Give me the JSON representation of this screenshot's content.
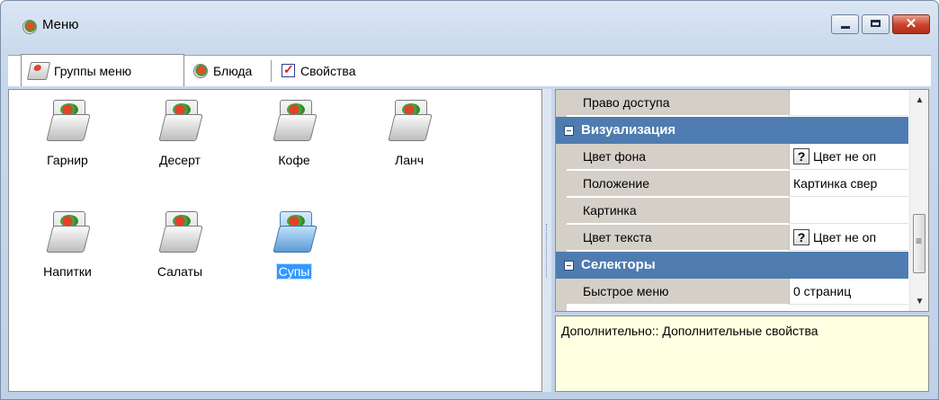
{
  "window": {
    "title": "Меню"
  },
  "tabs": [
    {
      "label": "Группы меню",
      "icon": "folder-icon"
    },
    {
      "label": "Блюда",
      "icon": "dish-icon"
    },
    {
      "label": "Свойства",
      "icon": "checklist-icon"
    }
  ],
  "groups": [
    {
      "label": "Гарнир",
      "selected": false
    },
    {
      "label": "Десерт",
      "selected": false
    },
    {
      "label": "Кофе",
      "selected": false
    },
    {
      "label": "Ланч",
      "selected": false
    },
    {
      "label": "Напитки",
      "selected": false
    },
    {
      "label": "Салаты",
      "selected": false
    },
    {
      "label": "Супы",
      "selected": true
    }
  ],
  "properties": {
    "rows": [
      {
        "name": "Право доступа",
        "value": ""
      },
      {
        "category": "Визуализация"
      },
      {
        "name": "Цвет фона",
        "value": "Цвет не оп",
        "has_q": "?"
      },
      {
        "name": "Положение",
        "value": "Картинка свер"
      },
      {
        "name": "Картинка",
        "value": ""
      },
      {
        "name": "Цвет текста",
        "value": "Цвет не оп",
        "has_q": "?"
      },
      {
        "category": "Селекторы"
      },
      {
        "name": "Быстрое меню",
        "value": "0 страниц"
      }
    ],
    "description": "Дополнительно:: Дополнительные свойства"
  },
  "colors": {
    "category_bar": "#4f7cb0",
    "selection": "#3399ff",
    "description_bg": "#ffffe1"
  }
}
